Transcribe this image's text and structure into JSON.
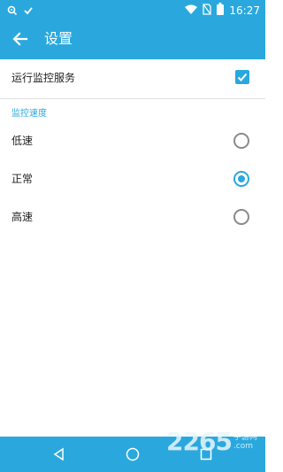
{
  "status_bar": {
    "time": "16:27",
    "icons": [
      "notification-icon",
      "check-icon",
      "wifi-icon",
      "no-sim-icon",
      "battery-icon"
    ]
  },
  "app_bar": {
    "title": "设置",
    "back_icon": "back-arrow-icon"
  },
  "settings": {
    "run_service": {
      "label": "运行监控服务",
      "checked": true
    },
    "speed_section": {
      "header": "监控速度",
      "options": [
        {
          "label": "低速",
          "selected": false
        },
        {
          "label": "正常",
          "selected": true
        },
        {
          "label": "高速",
          "selected": false
        }
      ]
    }
  },
  "nav_bar": {
    "buttons": [
      "back-triangle-icon",
      "home-circle-icon",
      "recents-square-icon"
    ]
  },
  "watermark": {
    "big": "2265",
    "small_top": "手游网",
    "small_bottom": ".com"
  },
  "colors": {
    "accent": "#2aa8de",
    "text": "#222222",
    "radio_off": "#8a8a8a"
  }
}
